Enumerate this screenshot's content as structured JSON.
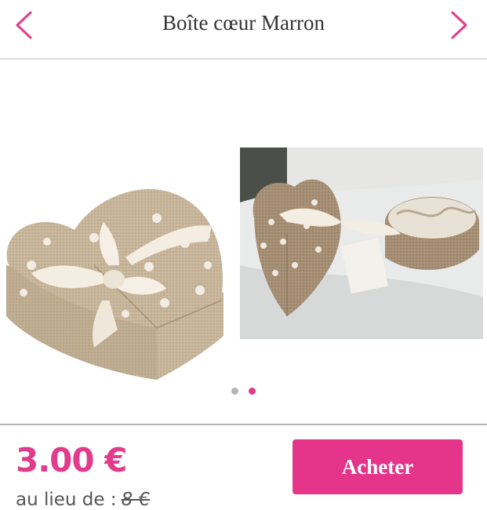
{
  "header": {
    "title": "Boîte cœur Marron",
    "prev_icon": "chevron-left-icon",
    "next_icon": "chevron-right-icon",
    "accent_color": "#e13c8b"
  },
  "gallery": {
    "slide_count": 2,
    "active_slide": 2,
    "dot_active_color": "#e13c8b",
    "dot_inactive_color": "#b5b5b5"
  },
  "footer": {
    "price": "3.00 €",
    "was_label": "au lieu de :",
    "old_price": "8 €",
    "buy_label": "Acheter",
    "buy_color": "#e5358b"
  }
}
